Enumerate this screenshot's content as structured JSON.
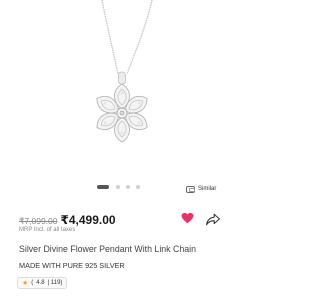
{
  "carousel": {
    "total": 4,
    "active": 0
  },
  "similar": {
    "label": "Similar",
    "icon": "similar-icon"
  },
  "price": {
    "mrp": "₹7,099.00",
    "sale": "₹4,499.00",
    "note": "MRP Incl. of all taxes"
  },
  "actions": {
    "wishlist_icon": "heart-icon",
    "share_icon": "share-icon",
    "heart_color": "#e8336b"
  },
  "product": {
    "title": "Silver Divine Flower Pendant With Link Chain",
    "subtitle": "MADE WITH PURE 925 SILVER"
  },
  "rating": {
    "value": "4.8",
    "count": "| 119)",
    "open": "(",
    "star_color": "#e3a72f"
  }
}
